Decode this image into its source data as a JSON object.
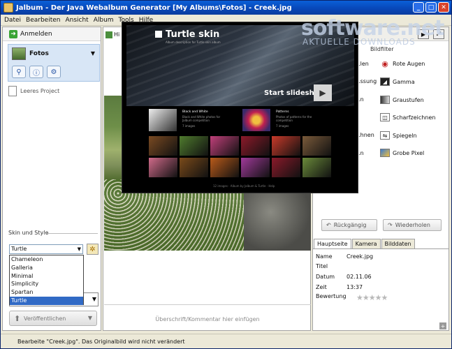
{
  "window": {
    "title": "Jalbum - Der Java Webalbum Generator [My Albums\\Fotos] - Creek.jpg"
  },
  "menu": [
    "Datei",
    "Bearbeiten",
    "Ansicht",
    "Album",
    "Tools",
    "Hilfe"
  ],
  "left": {
    "login_label": "Anmelden",
    "album_label": "Fotos",
    "empty_project": "Leeres Project",
    "skin_section": "Skin und Style",
    "skin_selected": "Turtle",
    "skin_options": [
      "Chameleon",
      "Galleria",
      "Minimal",
      "Simplicity",
      "Spartan",
      "Turtle"
    ],
    "publish_label": "Veröffentlichen"
  },
  "center": {
    "tab_label": "Hi",
    "caption_placeholder": "Überschrift/Kommentar hier einfügen"
  },
  "preview": {
    "title": "Turtle skin",
    "subtitle": "Album description for Turtle skin album",
    "slideshow_label": "Start slideshow",
    "albums": [
      {
        "title": "Black and White",
        "desc": "Black and White photos for Jalbum competition",
        "count": "7 images"
      },
      {
        "title": "Patterns",
        "desc": "Photos of patterns for the competition",
        "count": "7 images"
      }
    ],
    "footer": "12 images  ·  Album by Jalbum & Turtle  ·  Help",
    "grid_colors": [
      "#7a4a22",
      "#4f7b2e",
      "#c0407a",
      "#8c1a2a",
      "#c83a2a",
      "#7a5a3a",
      "#d06a8a",
      "#7a4a1a",
      "#b85a1a",
      "#a03a9a",
      "#8a1a2a",
      "#6a8a3a"
    ]
  },
  "watermark": {
    "line1": "software.net",
    "line2": "AKTUELLE DOWNLOADS"
  },
  "right": {
    "filter_title": "Bildfilter",
    "filters_left": [
      "...len",
      "...ssung",
      "...n",
      "...hnen",
      "...n"
    ],
    "filters": [
      {
        "label": "Rote Augen",
        "icon": "eye-icon"
      },
      {
        "label": "Gamma",
        "icon": "gamma-icon"
      },
      {
        "label": "Graustufen",
        "icon": "grayscale-icon"
      },
      {
        "label": "Scharfzeichnen",
        "icon": "sharpen-icon"
      },
      {
        "label": "Spiegeln",
        "icon": "mirror-icon"
      },
      {
        "label": "Grobe Pixel",
        "icon": "pixelate-icon"
      }
    ],
    "undo_label": "Rückgängig",
    "redo_label": "Wiederholen",
    "tabs": [
      "Hauptseite",
      "Kamera",
      "Bilddaten"
    ],
    "props": {
      "name_key": "Name",
      "name_val": "Creek.jpg",
      "title_key": "Titel",
      "title_val": "",
      "date_key": "Datum",
      "date_val": "02.11.06",
      "time_key": "Zeit",
      "time_val": "13:37",
      "rating_key": "Bewertung"
    }
  },
  "status": "Bearbeite \"Creek.jpg\". Das Originalbild wird nicht verändert"
}
